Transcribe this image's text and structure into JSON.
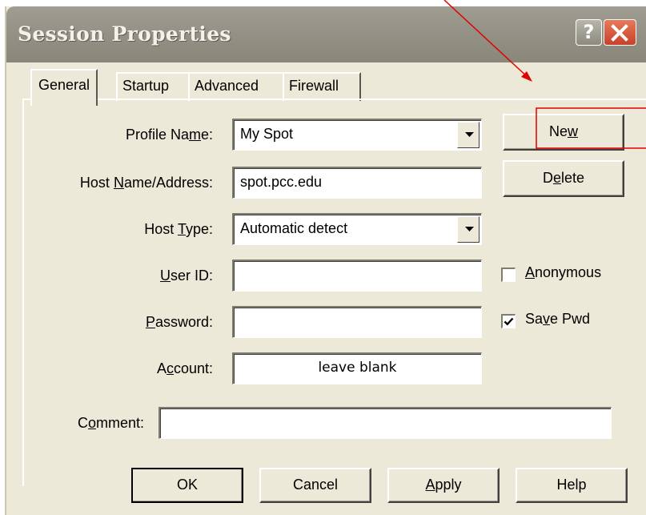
{
  "window": {
    "title": "Session Properties",
    "help_glyph": "?"
  },
  "tabs": [
    {
      "name": "general",
      "pre": "",
      "ul": "",
      "post": "General",
      "selected": true
    },
    {
      "name": "startup",
      "pre": "",
      "ul": "",
      "post": "Startup",
      "selected": false
    },
    {
      "name": "advanced",
      "pre": "",
      "ul": "",
      "post": "Advanced",
      "selected": false
    },
    {
      "name": "firewall",
      "pre": "",
      "ul": "",
      "post": "Firewall",
      "selected": false
    }
  ],
  "form": {
    "profile_name": {
      "pre": "Profile Na",
      "ul": "m",
      "post": "e:",
      "value": "My Spot"
    },
    "host_name": {
      "pre": "Host ",
      "ul": "N",
      "post": "ame/Address:",
      "value": "spot.pcc.edu"
    },
    "host_type": {
      "pre": "Host ",
      "ul": "T",
      "post": "ype:",
      "value": "Automatic detect"
    },
    "user_id": {
      "pre": "",
      "ul": "U",
      "post": "ser ID:",
      "value": ""
    },
    "password": {
      "pre": "",
      "ul": "P",
      "post": "assword:",
      "value": ""
    },
    "account": {
      "pre": "A",
      "ul": "c",
      "post": "count:",
      "value": "leave blank"
    },
    "comment": {
      "pre": "C",
      "ul": "o",
      "post": "mment:",
      "value": ""
    }
  },
  "side_buttons": {
    "new": {
      "pre": "Ne",
      "ul": "w",
      "post": ""
    },
    "delete": {
      "pre": "D",
      "ul": "e",
      "post": "lete"
    }
  },
  "checkboxes": {
    "anonymous": {
      "pre": "",
      "ul": "A",
      "post": "nonymous",
      "checked": false
    },
    "save_pwd": {
      "pre": "Sa",
      "ul": "v",
      "post": "e Pwd",
      "checked": true
    }
  },
  "bottom_buttons": {
    "ok": {
      "pre": "OK",
      "ul": "",
      "post": ""
    },
    "cancel": {
      "pre": "Cancel",
      "ul": "",
      "post": ""
    },
    "apply": {
      "pre": "",
      "ul": "A",
      "post": "pply"
    },
    "help": {
      "pre": "Help",
      "ul": "",
      "post": ""
    }
  },
  "annotation": {
    "color": "#e00000"
  },
  "colors": {
    "dialog_bg": "#ece9d8",
    "title_bar": "#98958a",
    "close_button": "#d25a3e"
  }
}
